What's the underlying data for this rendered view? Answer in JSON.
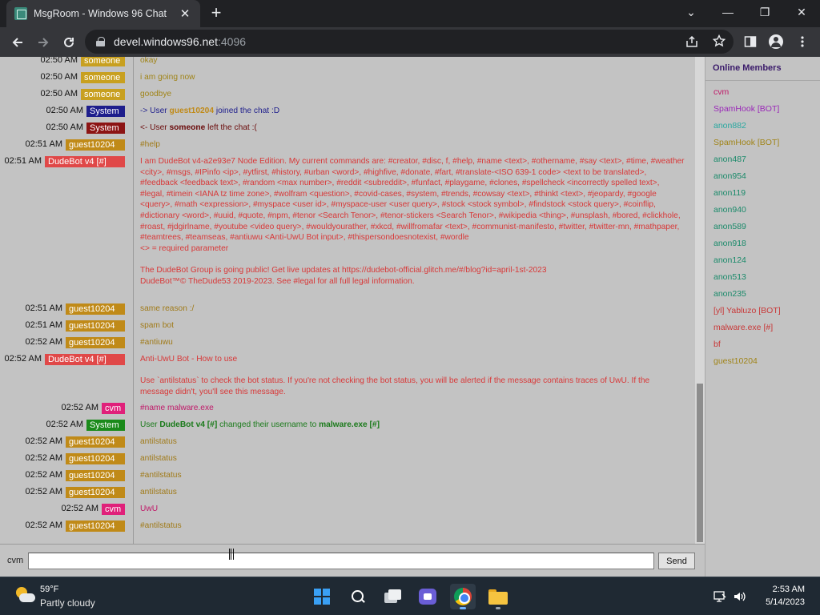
{
  "browser": {
    "tab_title": "MsgRoom - Windows 96 Chat",
    "tab_close": "✕",
    "new_tab": "+",
    "url_host": "devel.windows96.net",
    "url_port": ":4096",
    "window_controls": {
      "minimize": "—",
      "restore": "❐",
      "close": "✕",
      "tab_list": "⌄"
    },
    "icons": [
      "back-icon",
      "forward-icon",
      "reload-icon",
      "lock-icon",
      "share-icon",
      "star-icon",
      "side-panel-icon",
      "profile-icon",
      "menu-icon"
    ]
  },
  "chat": {
    "messages": [
      {
        "time": "02:50 AM",
        "user": "someone",
        "user_bg": "#c8a020",
        "user_fg": "#ffffff",
        "text": "okay",
        "text_color": "#a08418"
      },
      {
        "time": "02:50 AM",
        "user": "someone",
        "user_bg": "#c8a020",
        "user_fg": "#ffffff",
        "text": "i am going now",
        "text_color": "#a08418"
      },
      {
        "time": "02:50 AM",
        "user": "someone",
        "user_bg": "#c8a020",
        "user_fg": "#ffffff",
        "text": "goodbye",
        "text_color": "#a08418"
      },
      {
        "time": "02:50 AM",
        "user": "System",
        "user_bg": "#1e1e8c",
        "user_fg": "#ffffff",
        "text_color": "#1e1e8c",
        "text_pre": "-> User ",
        "text_bold": "guest10204",
        "bold_color": "#c08a18",
        "text_post": " joined the chat :D"
      },
      {
        "time": "02:50 AM",
        "user": "System",
        "user_bg": "#8c1414",
        "user_fg": "#ffffff",
        "text_color": "#6a0a0a",
        "text_pre": "<- User ",
        "text_bold": "someone",
        "bold_color": "#6a0a0a",
        "text_post": " left the chat :("
      },
      {
        "time": "02:51 AM",
        "user": "guest10204",
        "user_bg": "#c08a18",
        "user_fg": "#ffffff",
        "text": "#help",
        "text_color": "#a07a18"
      },
      {
        "time": "02:51 AM",
        "user": "DudeBot v4 [#]",
        "user_bg": "#e04848",
        "user_fg": "#ffffff",
        "text_color": "#d83838",
        "text": "I am DudeBot v4-a2e93e7 Node Edition. My current commands are: #creator, #disc, f, #help, #name <text>, #othername, #say <text>, #time, #weather <city>, #msgs, #IPinfo <ip>, #ytfirst, #history, #urban <word>, #highfive, #donate, #fart, #translate-<ISO 639-1 code> <text to be translated>, #feedback <feedback text>, #random <max number>, #reddit <subreddit>, #funfact, #playgame, #clones, #spellcheck <incorrectly spelled text>, #legal, #timein <IANA tz time zone>, #wolfram <question>, #covid-cases, #system, #trends, #cowsay <text>, #thinkt <text>, #jeopardy, #google <query>, #math <expression>, #myspace <user id>, #myspace-user <user query>, #stock <stock symbol>, #findstock <stock query>, #coinflip, #dictionary <word>, #uuid, #quote, #npm, #tenor <Search Tenor>, #tenor-stickers <Search Tenor>, #wikipedia <thing>, #unsplash, #bored, #clickhole, #roast, #jdgirlname, #youtube <video query>, #wouldyourather, #xkcd, #willfromafar <text>, #communist-manifesto, #twitter, #twitter-mn, #mathpaper, #teamtrees, #teamseas, #antiuwu <Anti-UwU Bot input>, #thispersondoesnotexist, #wordle\n<> = required parameter\n\nThe DudeBot Group is going public! Get live updates at https://dudebot-official.glitch.me/#/blog?id=april-1st-2023\nDudeBot™© TheDude53 2019-2023. See #legal for all full legal information."
      },
      {
        "time": "02:51 AM",
        "user": "guest10204",
        "user_bg": "#c08a18",
        "user_fg": "#ffffff",
        "text": "same reason :/",
        "text_color": "#a07a18"
      },
      {
        "time": "02:51 AM",
        "user": "guest10204",
        "user_bg": "#c08a18",
        "user_fg": "#ffffff",
        "text": "spam bot",
        "text_color": "#a07a18"
      },
      {
        "time": "02:52 AM",
        "user": "guest10204",
        "user_bg": "#c08a18",
        "user_fg": "#ffffff",
        "text": "#antiuwu",
        "text_color": "#a07a18"
      },
      {
        "time": "02:52 AM",
        "user": "DudeBot v4 [#]",
        "user_bg": "#e04848",
        "user_fg": "#ffffff",
        "text_color": "#d83838",
        "text": "Anti-UwU Bot - How to use\n\nUse `antilstatus` to check the bot status. If you're not checking the bot status, you will be alerted if the message contains traces of UwU. If the message didn't, you'll see this message."
      },
      {
        "time": "02:52 AM",
        "user": "cvm",
        "user_bg": "#e0207a",
        "user_fg": "#ffffff",
        "text": "#name malware.exe",
        "text_color": "#c01868"
      },
      {
        "time": "02:52 AM",
        "user": "System",
        "user_bg": "#1a8a1a",
        "user_fg": "#ffffff",
        "text_color": "#1a7a1a",
        "text_pre": "User ",
        "text_bold": "DudeBot v4 [#]",
        "bold_color": "#1a7a1a",
        "text_mid": " changed their username to ",
        "text_bold2": "malware.exe [#]",
        "text_post": ""
      },
      {
        "time": "02:52 AM",
        "user": "guest10204",
        "user_bg": "#c08a18",
        "user_fg": "#ffffff",
        "text": "antilstatus",
        "text_color": "#a07a18"
      },
      {
        "time": "02:52 AM",
        "user": "guest10204",
        "user_bg": "#c08a18",
        "user_fg": "#ffffff",
        "text": "antilstatus",
        "text_color": "#a07a18"
      },
      {
        "time": "02:52 AM",
        "user": "guest10204",
        "user_bg": "#c08a18",
        "user_fg": "#ffffff",
        "text": "#antilstatus",
        "text_color": "#a07a18"
      },
      {
        "time": "02:52 AM",
        "user": "guest10204",
        "user_bg": "#c08a18",
        "user_fg": "#ffffff",
        "text": "antilstatus",
        "text_color": "#a07a18"
      },
      {
        "time": "02:52 AM",
        "user": "cvm",
        "user_bg": "#e0207a",
        "user_fg": "#ffffff",
        "text": "UwU",
        "text_color": "#c01868"
      },
      {
        "time": "02:52 AM",
        "user": "guest10204",
        "user_bg": "#c08a18",
        "user_fg": "#ffffff",
        "text": "#antilstatus",
        "text_color": "#a07a18"
      }
    ]
  },
  "members": {
    "title": "Online Members",
    "list": [
      {
        "name": "cvm",
        "color": "#c01868"
      },
      {
        "name": "SpamHook [BOT]",
        "color": "#9a28b8"
      },
      {
        "name": "anon882",
        "color": "#28a8a0"
      },
      {
        "name": "SpamHook [BOT]",
        "color": "#a08418"
      },
      {
        "name": "anon487",
        "color": "#1a8a6a"
      },
      {
        "name": "anon954",
        "color": "#1a8a6a"
      },
      {
        "name": "anon119",
        "color": "#1a8a6a"
      },
      {
        "name": "anon940",
        "color": "#1a8a6a"
      },
      {
        "name": "anon589",
        "color": "#1a8a6a"
      },
      {
        "name": "anon918",
        "color": "#1a8a6a"
      },
      {
        "name": "anon124",
        "color": "#1a8a6a"
      },
      {
        "name": "anon513",
        "color": "#1a8a6a"
      },
      {
        "name": "anon235",
        "color": "#1a8a6a"
      },
      {
        "name": "[yl] Yabluzo [BOT]",
        "color": "#c83838"
      },
      {
        "name": "malware.exe [#]",
        "color": "#c83838"
      },
      {
        "name": "bf",
        "color": "#c83838"
      },
      {
        "name": "guest10204",
        "color": "#a08418"
      }
    ]
  },
  "input": {
    "nick": "cvm",
    "value": "",
    "send_label": "Send"
  },
  "taskbar": {
    "weather_temp": "59°F",
    "weather_desc": "Partly cloudy",
    "time": "2:53 AM",
    "date": "5/14/2023",
    "apps": [
      "start-icon",
      "search-icon",
      "task-view-icon",
      "meet-icon",
      "chrome-icon",
      "file-explorer-icon"
    ],
    "tray": [
      "network-icon",
      "volume-icon"
    ]
  }
}
